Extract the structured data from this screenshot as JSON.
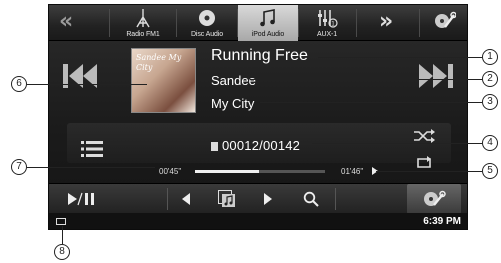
{
  "topbar": {
    "sources": [
      {
        "label": "Radio FM1",
        "icon": "antenna-icon"
      },
      {
        "label": "Disc Audio",
        "icon": "disc-icon"
      },
      {
        "label": "iPod Audio",
        "icon": "music-note-icon"
      },
      {
        "label": "AUX-1",
        "icon": "mixer-icon"
      }
    ],
    "active_source": "iPod Audio"
  },
  "track": {
    "title": "Running Free",
    "artist": "Sandee",
    "album": "My City",
    "album_art_text": "Sandee My City"
  },
  "counter": "00012/00142",
  "progress": {
    "elapsed": "00'45\"",
    "remaining": "01'46\"",
    "fraction": 0.49
  },
  "status": {
    "clock": "6:39 PM"
  },
  "callouts": [
    "1",
    "2",
    "3",
    "4",
    "5",
    "6",
    "7",
    "8"
  ],
  "colors": {
    "screen_bg": "#1b1b1b",
    "active_tab": "#c4c4c4",
    "text": "#ffffff"
  }
}
